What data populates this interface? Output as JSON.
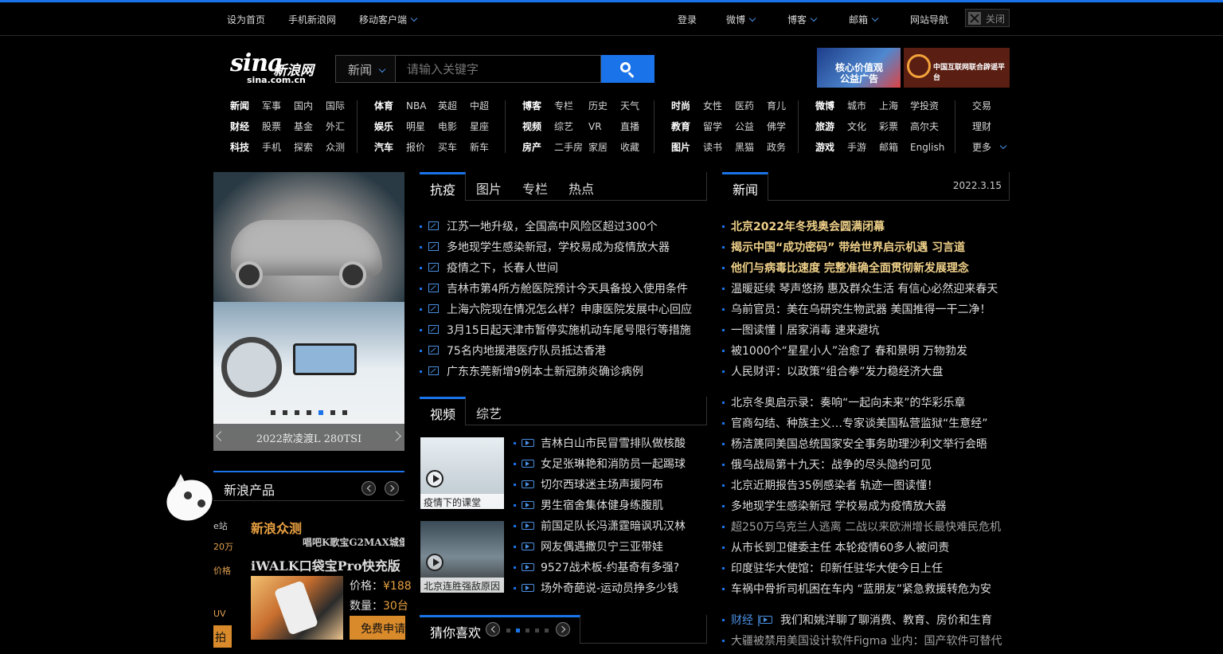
{
  "topbar": {
    "left": [
      "设为首页",
      "手机新浪网",
      "移动客户端"
    ],
    "right": [
      "登录",
      "微博",
      "博客",
      "邮箱",
      "网站导航"
    ],
    "close_label": "关闭"
  },
  "logo": {
    "brand": "sina",
    "cn": "新浪网",
    "domain": "sina.com.cn"
  },
  "search": {
    "category": "新闻",
    "placeholder": "请输入关键字"
  },
  "ads": {
    "ad1": "核心价值观公益广告",
    "ad2": "中国互联网联合辟谣平台"
  },
  "nav": {
    "groups": [
      [
        [
          "新闻",
          "军事",
          "国内",
          "国际"
        ],
        [
          "财经",
          "股票",
          "基金",
          "外汇"
        ],
        [
          "科技",
          "手机",
          "探索",
          "众测"
        ]
      ],
      [
        [
          "体育",
          "NBA",
          "英超",
          "中超"
        ],
        [
          "娱乐",
          "明星",
          "电影",
          "星座"
        ],
        [
          "汽车",
          "报价",
          "买车",
          "新车"
        ]
      ],
      [
        [
          "博客",
          "专栏",
          "历史",
          "天气"
        ],
        [
          "视频",
          "综艺",
          "VR",
          "直播"
        ],
        [
          "房产",
          "二手房",
          "家居",
          "收藏"
        ]
      ],
      [
        [
          "时尚",
          "女性",
          "医药",
          "育儿"
        ],
        [
          "教育",
          "留学",
          "公益",
          "佛学"
        ],
        [
          "图片",
          "读书",
          "黑猫",
          "政务"
        ]
      ],
      [
        [
          "微博",
          "城市",
          "上海",
          "学投资"
        ],
        [
          "旅游",
          "文化",
          "彩票",
          "高尔夫"
        ],
        [
          "游戏",
          "手游",
          "邮箱",
          "English"
        ]
      ],
      [
        [
          "交易"
        ],
        [
          "理财"
        ],
        [
          "更多"
        ]
      ]
    ]
  },
  "slider": {
    "caption": "2022款凌渡L 280TSI",
    "dot_count": 7,
    "active_dot": 5
  },
  "products": {
    "title": "新浪产品",
    "zhongce": "新浪众测",
    "marquee": "唱吧K歌宝G2MAX城堡",
    "name": "iWALK口袋宝Pro快充版",
    "price_label": "价格：",
    "price_value": "¥188",
    "qty_label": "数量：",
    "qty_value": "30台",
    "buy_label": "免费申请",
    "side_labels": [
      "e站",
      "20万",
      "价格",
      "UV"
    ],
    "side_buy": "拍"
  },
  "epidemic": {
    "tabs": [
      "抗疫",
      "图片",
      "专栏",
      "热点"
    ],
    "items": [
      "江苏一地升级，全国高中风险区超过300个",
      "多地现学生感染新冠，学校易成为疫情放大器",
      "疫情之下，长春人世间",
      "吉林市第4所方舱医院预计今天具备投入使用条件",
      "上海六院现在情况怎么样？申康医院发展中心回应",
      "3月15日起天津市暂停实施机动车尾号限行等措施",
      "75名内地援港医疗队员抵达香港",
      "广东东莞新增9例本土新冠肺炎确诊病例"
    ]
  },
  "video": {
    "tabs": [
      "视频",
      "综艺"
    ],
    "thumbs": [
      "疫情下的课堂",
      "北京连胜强敌原因"
    ],
    "items": [
      "吉林白山市民冒雪排队做核酸",
      "女足张琳艳和消防员一起踢球",
      "切尔西球迷主场声援阿布",
      "男生宿舍集体健身练腹肌",
      "前国足队长冯潇霆暗讽巩汉林",
      "网友偶遇撒贝宁三亚带娃",
      "9527战术板-约基奇有多强?",
      "场外奇葩说-运动员挣多少钱"
    ]
  },
  "guess": {
    "title": "猜你喜欢",
    "dot_count": 5,
    "active_dot": 2
  },
  "right_news": {
    "tab": "新闻",
    "date": "2022.3.15",
    "headlines": [
      "北京2022年冬残奥会圆满闭幕",
      "揭示中国“成功密码” 带给世界启示机遇 习言道",
      "他们与病毒比速度 完整准确全面贯彻新发展理念"
    ],
    "group1": [
      "温暖延续 琴声悠扬 惠及群众生活 有信心必然迎来春天",
      "乌前官员：美在乌研究生物武器 美国推得一干二净！",
      "一图读懂丨居家消毒 速来避坑",
      "被1000个“星星小人”治愈了 春和景明 万物勃发",
      "人民财评：以政策“组合拳”发力稳经济大盘"
    ],
    "group2": [
      "北京冬奥启示录：奏响“一起向未来”的华彩乐章",
      "官商勾结、种族主义…专家谈美国私营监狱“生意经”",
      "杨洁篪同美国总统国家安全事务助理沙利文举行会晤",
      "俄乌战局第十九天：战争的尽头隐约可见",
      "北京近期报告35例感染者 轨迹一图读懂！",
      "多地现学生感染新冠 学校易成为疫情放大器",
      "超250万乌克兰人逃离 二战以来欧洲增长最快难民危机",
      "从市长到卫健委主任 本轮疫情60多人被问责",
      "印度驻华大使馆：印新任驻华大使今日上任",
      "车祸中骨折司机困在车内 “蓝朋友”紧急救援转危为安"
    ],
    "finance_label": "财经 |",
    "finance_item": "我们和姚洋聊了聊消费、教育、房价和生育",
    "last_item": "大疆被禁用美国设计软件Figma 业内：国产软件可替代"
  }
}
